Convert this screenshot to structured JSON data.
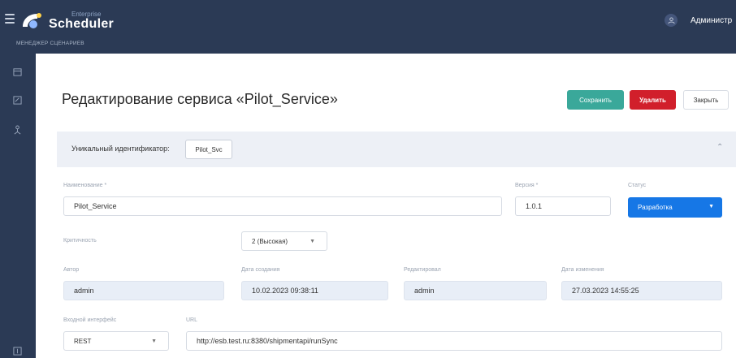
{
  "header": {
    "brand_small": "Enterprise",
    "brand_big": "Scheduler",
    "subtitle": "МЕНЕДЖЕР СЦЕНАРИЕВ",
    "user_name": "Администр"
  },
  "page": {
    "title": "Редактирование сервиса «Pilot_Service»"
  },
  "toolbar": {
    "save_label": "Сохранить",
    "delete_label": "Удалить",
    "close_label": "Закрыть"
  },
  "identifier": {
    "label": "Уникальный идентификатор:",
    "value": "Pilot_Svc"
  },
  "form": {
    "name_label": "Наименование *",
    "name_value": "Pilot_Service",
    "version_label": "Версия *",
    "version_value": "1.0.1",
    "status_label": "Статус",
    "status_value": "Разработка",
    "criticality_label": "Критичность",
    "criticality_value": "2 (Высокая)",
    "author_label": "Автор",
    "author_value": "admin",
    "created_label": "Дата создания",
    "created_value": "10.02.2023 09:38:11",
    "editor_label": "Редактировал",
    "editor_value": "admin",
    "modified_label": "Дата изменения",
    "modified_value": "27.03.2023 14:55:25",
    "interface_label": "Входной интерфейс",
    "interface_value": "REST",
    "url_label": "URL",
    "url_value": "http://esb.test.ru:8380/shipmentapi/runSync"
  },
  "colors": {
    "nav_bg": "#2b3a55",
    "save": "#3aa89a",
    "delete": "#d11f2b",
    "status": "#1677e6",
    "panel": "#edf0f6"
  },
  "icons": [
    "menu-icon",
    "logo-icon",
    "user-icon",
    "calendar-icon",
    "edit-icon",
    "tree-icon",
    "logout-icon",
    "chevron-up-icon",
    "chevron-down-icon"
  ]
}
